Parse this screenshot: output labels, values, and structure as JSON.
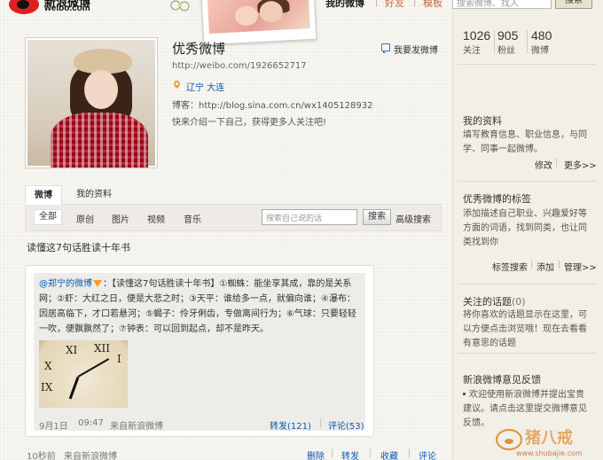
{
  "header": {
    "logo_cn": "新浪微博",
    "logo_en": "weibo.com",
    "nav_mine": "我的微博",
    "nav_friends": "好友",
    "nav_templates": "模板",
    "search_placeholder": "搜索微博、找人",
    "search_button": "搜索"
  },
  "profile": {
    "name": "优秀微博",
    "url": "http://weibo.com/1926652717",
    "location": "辽宁 大连",
    "blog": "博客：http://blog.sina.com.cn/wx1405128932",
    "intro": "快来介绍一下自己，获得更多人关注吧!",
    "post_link": "我要发微博"
  },
  "tabs": {
    "weibo": "微博",
    "myinfo": "我的资料"
  },
  "filters": {
    "all": "全部",
    "original": "原创",
    "pictures": "图片",
    "video": "视频",
    "music": "音乐",
    "search_placeholder": "搜索自己说的话",
    "search_button": "搜索",
    "advanced": "高级搜索"
  },
  "post": {
    "title": "读懂这7句话胜读十年书",
    "author": "@郑宁的微博",
    "repost_text": "：【读懂这7句话胜读十年书】①蜘蛛：能坐享其成，靠的是关系网；②虾：大红之日，便是大悲之时；③天平：谁给多一点，就偏向谁；④瀑布：因居高临下，才口若悬河；⑤蝎子：伶牙俐齿，专做离间行为；⑥气球：只要轻轻一吹，便飘飘然了；⑦钟表：可以回到起点，却不是昨天。",
    "date": "9月1日",
    "time": "09:47",
    "source": "来自新浪微博",
    "forward": "转发(121)",
    "comment": "评论(53)"
  },
  "footer_meta": {
    "time": "10秒前",
    "source": "来自新浪微博",
    "delete": "删除",
    "forward": "转发",
    "favorite": "收藏",
    "comment": "评论"
  },
  "sidebar": {
    "stats": [
      {
        "value": "1026",
        "label": "关注"
      },
      {
        "value": "905",
        "label": "粉丝"
      },
      {
        "value": "480",
        "label": "微博"
      }
    ],
    "info_title": "我的资料",
    "info_text": "填写教育信息、职业信息，与同学、同事一起微博。",
    "info_edit": "修改",
    "info_more": "更多>>",
    "tags_title": "优秀微博的标签",
    "tags_text": "添加描述自己职业、兴趣爱好等方面的词语，找到同类，也让同类找到你",
    "tags_search": "标签搜索",
    "tags_add": "添加",
    "tags_manage": "管理>>",
    "topics_title": "关注的话题",
    "topics_count": "(0)",
    "topics_text": "将你喜欢的话题显示在这里，可以方便点击浏览哦！现在去看看有意思的话题",
    "feedback_title": "新浪微博意见反馈",
    "feedback_text": "欢迎使用新浪微博并提出宝贵建议。请点击这里提交微博意见反馈。"
  },
  "watermark": {
    "cn": "猪八戒",
    "url": "www.shubajie.com"
  },
  "colors": {
    "link": "#0a5ab4",
    "nav_secondary": "#c56a4a",
    "logo_red": "#e02020"
  }
}
